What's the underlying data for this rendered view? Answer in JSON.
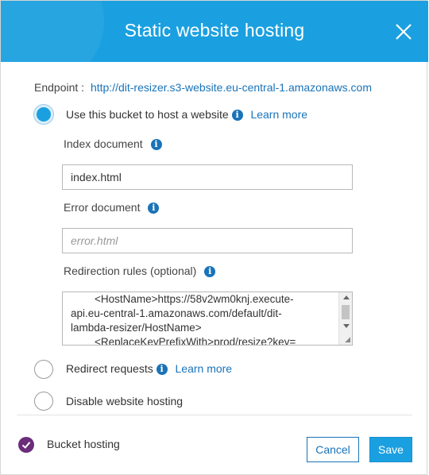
{
  "dialog": {
    "title": "Static website hosting",
    "close_icon": "close-icon"
  },
  "endpoint": {
    "label": "Endpoint :",
    "url": "http://dit-resizer.s3-website.eu-central-1.amazonaws.com"
  },
  "options": {
    "host": {
      "label": "Use this bucket to host a website",
      "learn_more": "Learn more",
      "selected": true
    },
    "redirect": {
      "label": "Redirect requests",
      "learn_more": "Learn more",
      "selected": false
    },
    "disable": {
      "label": "Disable website hosting",
      "selected": false
    }
  },
  "fields": {
    "index_document": {
      "label": "Index document",
      "value": "index.html"
    },
    "error_document": {
      "label": "Error document",
      "placeholder": "error.html",
      "value": ""
    },
    "redirection_rules": {
      "label": "Redirection rules (optional)",
      "lines": [
        "        <HostName>https://58v2wm0knj.execute-",
        "api.eu-central-1.amazonaws.com/default/dit-",
        "lambda-resizer/HostName>",
        "        <ReplaceKeyPrefixWith>prod/resize?key="
      ]
    }
  },
  "footer": {
    "status_label": "Bucket hosting",
    "cancel_label": "Cancel",
    "save_label": "Save"
  },
  "colors": {
    "header": "#1aa0e0",
    "link": "#1a73b8",
    "status_check": "#6b2c7a"
  }
}
